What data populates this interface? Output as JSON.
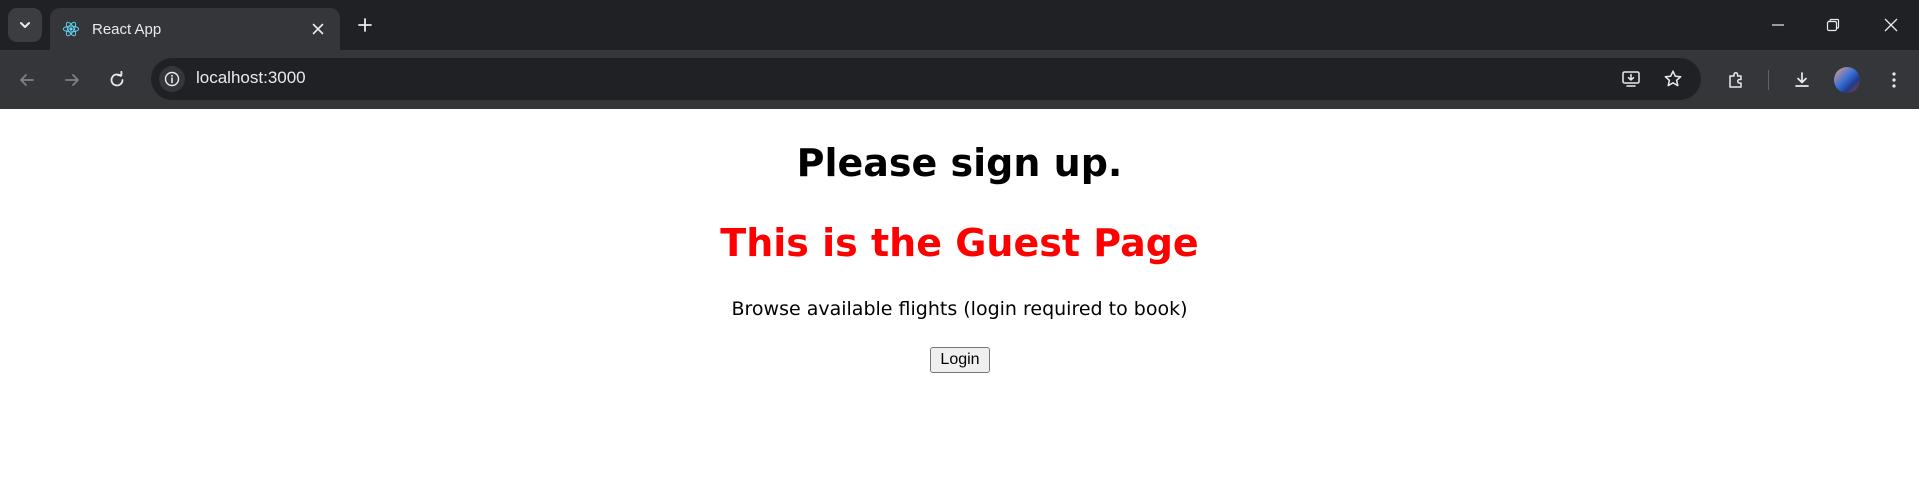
{
  "browser": {
    "tab_title": "React App",
    "url": "localhost:3000",
    "icons": {
      "tab_search": "chevron-down-icon",
      "favicon": "react-icon",
      "tab_close": "close-icon",
      "new_tab": "plus-icon",
      "minimize": "minimize-icon",
      "restore": "restore-icon",
      "close_window": "close-icon",
      "back": "arrow-left-icon",
      "forward": "arrow-right-icon",
      "reload": "reload-icon",
      "site_info": "info-icon",
      "install": "install-icon",
      "bookmark": "star-icon",
      "extensions": "puzzle-icon",
      "downloads": "download-icon",
      "profile": "avatar",
      "menu": "kebab-menu-icon"
    }
  },
  "page": {
    "signup_heading": "Please sign up.",
    "guest_heading": "This is the Guest Page",
    "guest_heading_color": "#ff0000",
    "browse_text": "Browse available flights (login required to book)",
    "login_button_label": "Login"
  },
  "colors": {
    "tabstrip_bg": "#202124",
    "toolbar_bg": "#35363a",
    "react_blue": "#61dafb"
  }
}
